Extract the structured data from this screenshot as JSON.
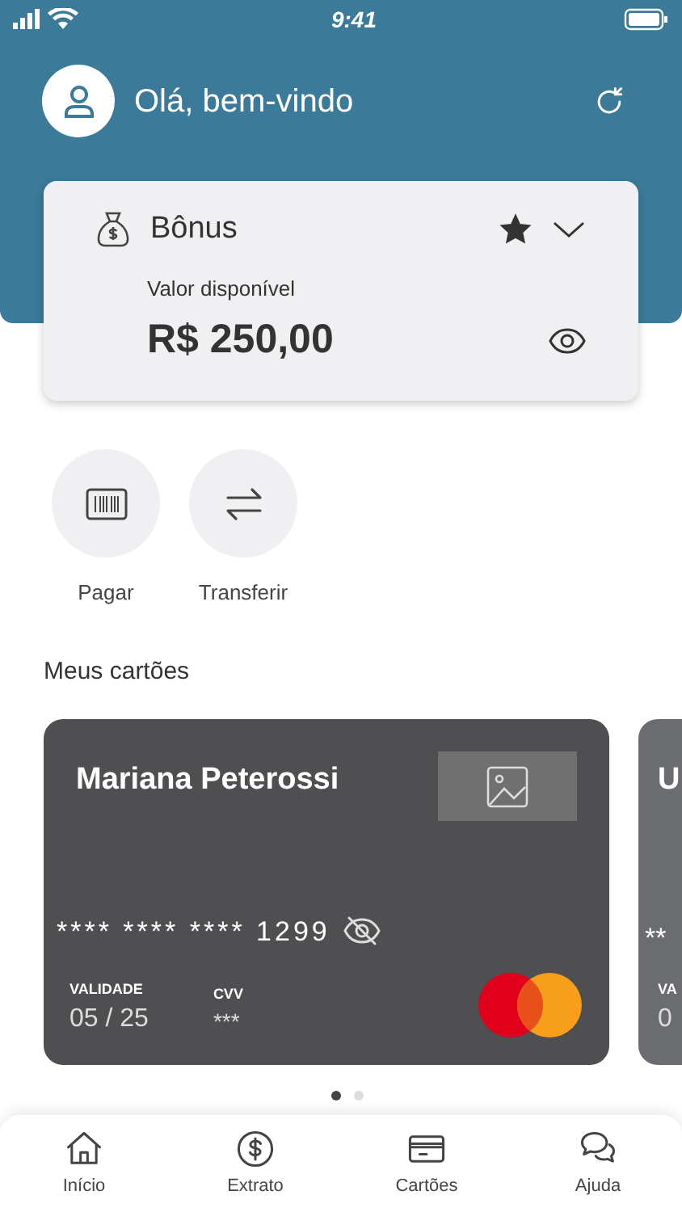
{
  "status_bar": {
    "time": "9:41"
  },
  "header": {
    "greeting": "Olá, bem-vindo"
  },
  "balance_card": {
    "title": "Bônus",
    "favorite": true,
    "label": "Valor disponível",
    "amount": "R$ 250,00"
  },
  "actions": [
    {
      "label": "Pagar",
      "kind": "barcode"
    },
    {
      "label": "Transferir",
      "kind": "transfer"
    }
  ],
  "cards_section": {
    "title": "Meus cartões",
    "cards": [
      {
        "holder": "Mariana Peterossi",
        "number": "**** **** **** 1299",
        "expiry_label": "VALIDADE",
        "expiry": "05 / 25",
        "cvv_label": "CVV",
        "cvv": "***",
        "kind": "full"
      },
      {
        "holder": "U",
        "number": "**",
        "expiry_label": "VA",
        "expiry": "0",
        "kind": "partial"
      }
    ],
    "dots": [
      {
        "selected": true
      },
      {
        "selected": false
      }
    ]
  },
  "bottom_nav": [
    {
      "label": "Início",
      "kind": "home"
    },
    {
      "label": "Extrato",
      "kind": "statement"
    },
    {
      "label": "Cartões",
      "kind": "cards"
    },
    {
      "label": "Ajuda",
      "kind": "help"
    }
  ]
}
